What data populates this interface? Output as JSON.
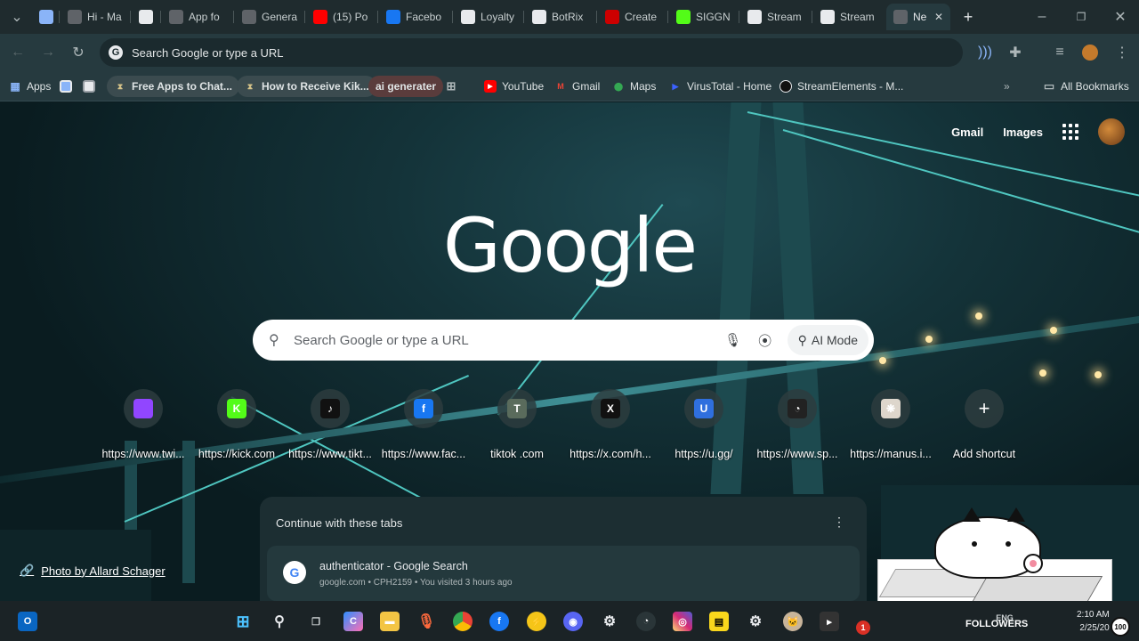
{
  "tabs": [
    {
      "title": "",
      "color": "#8ab4f8"
    },
    {
      "title": "Hi - Ma",
      "color": "#5f6368"
    },
    {
      "title": "",
      "color": "#e8eaed"
    },
    {
      "title": "App fo",
      "color": "#5f6368"
    },
    {
      "title": "Genera",
      "color": "#5f6368"
    },
    {
      "title": "(15) Po",
      "color": "#ff0000"
    },
    {
      "title": "Facebo",
      "color": "#1877f2"
    },
    {
      "title": "Loyalty",
      "color": "#e8eaed"
    },
    {
      "title": "BotRix",
      "color": "#e8eaed"
    },
    {
      "title": "Create",
      "color": "#cc0000"
    },
    {
      "title": "SIGGN",
      "color": "#53fc18"
    },
    {
      "title": "Stream",
      "color": "#e8eaed"
    },
    {
      "title": "Stream",
      "color": "#e8eaed"
    },
    {
      "title": "Ne",
      "color": "#5f6368",
      "active": true
    }
  ],
  "omnibox": {
    "text": "Search Google or type a URL"
  },
  "bookmarks": [
    {
      "label": "Apps"
    },
    {
      "label": "Free Apps to Chat..."
    },
    {
      "label": "How to Receive Kik..."
    },
    {
      "label": "ai generater"
    },
    {
      "label": "YouTube"
    },
    {
      "label": "Gmail"
    },
    {
      "label": "Maps"
    },
    {
      "label": "VirusTotal - Home"
    },
    {
      "label": "StreamElements - M..."
    },
    {
      "label": "All Bookmarks"
    }
  ],
  "ntp": {
    "gmail": "Gmail",
    "images": "Images",
    "logo": "Google",
    "search_placeholder": "Search Google or type a URL",
    "ai_mode": "AI Mode",
    "shortcuts": [
      {
        "label": "https://www.twi...",
        "icon": "twitch-icon",
        "glyph": "",
        "color": "#9146ff"
      },
      {
        "label": "https://kick.com",
        "icon": "kick-icon",
        "glyph": "K",
        "color": "#53fc18"
      },
      {
        "label": "https://www.tikt...",
        "icon": "tiktok-icon",
        "glyph": "♪",
        "color": "#111111"
      },
      {
        "label": "https://www.fac...",
        "icon": "facebook-icon",
        "glyph": "f",
        "color": "#1877f2"
      },
      {
        "label": "tiktok .com",
        "icon": "letter-t-icon",
        "glyph": "T",
        "color": "#5a6b5c"
      },
      {
        "label": "https://x.com/h...",
        "icon": "x-icon",
        "glyph": "X",
        "color": "#111111"
      },
      {
        "label": "https://u.gg/",
        "icon": "ugg-icon",
        "glyph": "U",
        "color": "#2f6fde"
      },
      {
        "label": "https://www.sp...",
        "icon": "speedometer-icon",
        "glyph": "◔",
        "color": "#222222"
      },
      {
        "label": "https://manus.i...",
        "icon": "manus-icon",
        "glyph": "❋",
        "color": "#ddd6cc"
      },
      {
        "label": "Add shortcut",
        "icon": "plus-icon",
        "glyph": "+",
        "color": "#3c4d50"
      }
    ],
    "photo_credit": "Photo by Allard Schager",
    "continue": {
      "heading": "Continue with these tabs",
      "item_title": "authenticator - Google Search",
      "item_sub": "google.com • CPH2159 • You visited 3 hours ago"
    }
  },
  "taskbar": {
    "followers": "FOLLOWERS",
    "time": "2:10 AM",
    "date": "2/25/20",
    "count": "100",
    "lang": "ENG",
    "badge": "1"
  }
}
